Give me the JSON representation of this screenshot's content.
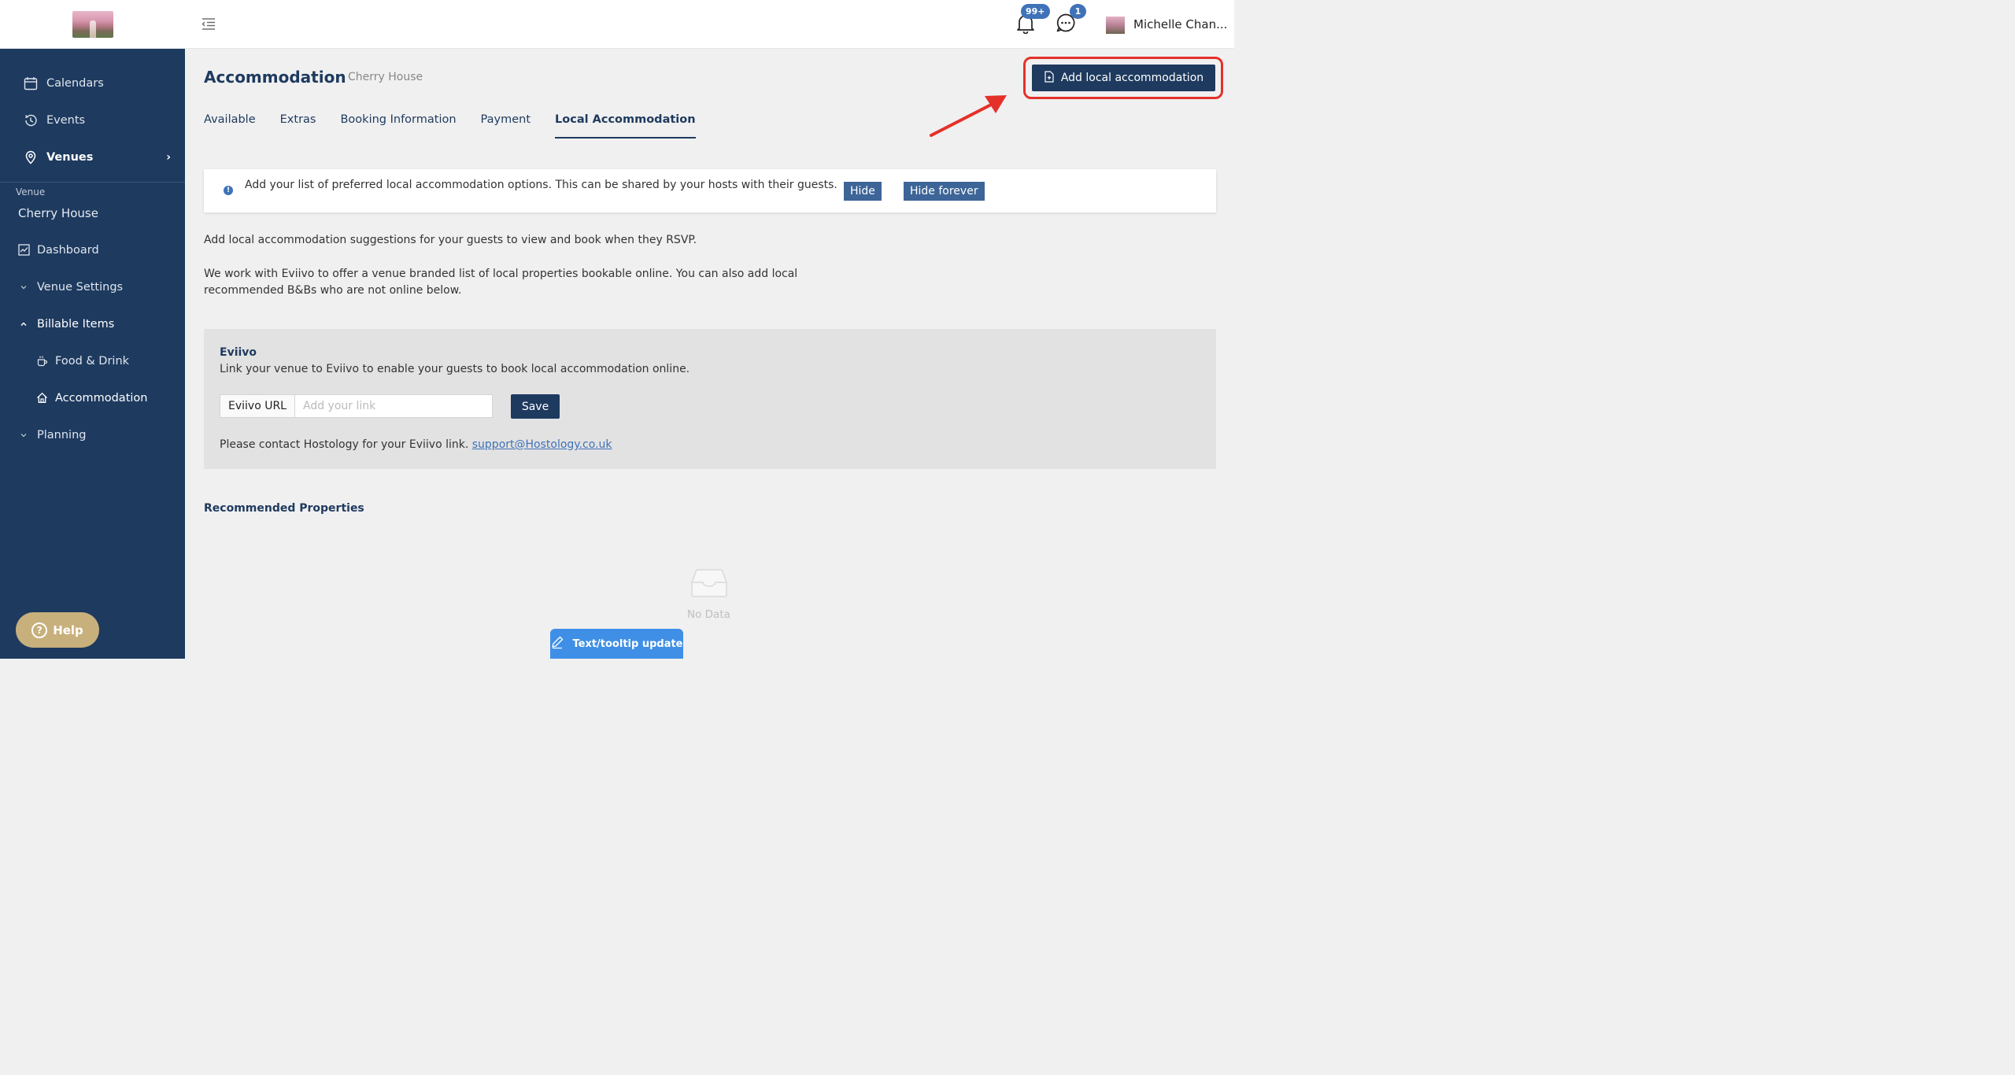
{
  "sidebar": {
    "nav": [
      {
        "label": "Calendars",
        "icon": "calendar-icon"
      },
      {
        "label": "Events",
        "icon": "history-icon"
      },
      {
        "label": "Venues",
        "icon": "location-pin-icon"
      }
    ],
    "section_label": "Venue",
    "venue_name": "Cherry House",
    "items": [
      {
        "label": "Dashboard",
        "icon": "dashboard-icon"
      },
      {
        "label": "Venue Settings",
        "icon": "chevron-down-icon"
      },
      {
        "label": "Billable Items",
        "icon": "chevron-up-icon"
      },
      {
        "label": "Food & Drink",
        "icon": "coffee-cup-icon"
      },
      {
        "label": "Accommodation",
        "icon": "home-icon"
      },
      {
        "label": "Planning",
        "icon": "chevron-down-icon"
      }
    ],
    "help_label": "Help"
  },
  "header": {
    "notifications_count": "99+",
    "messages_count": "1",
    "user_name": "Michelle Chan..."
  },
  "page": {
    "title": "Accommodation",
    "subtitle": "Cherry House",
    "add_button": "Add local accommodation",
    "tabs": [
      "Available",
      "Extras",
      "Booking Information",
      "Payment",
      "Local Accommodation"
    ],
    "active_tab": "Local Accommodation",
    "info": {
      "text": "Add your list of preferred local accommodation options. This can be shared by your hosts with their guests.",
      "hide": "Hide",
      "hide_forever": "Hide forever"
    },
    "para1": "Add local accommodation suggestions for your guests to view and book when they RSVP.",
    "para2": "We work with Eviivo to offer a venue branded list of local properties bookable online. You can also add local recommended B&Bs who are not online below.",
    "eviivo": {
      "title": "Eviivo",
      "description": "Link your venue to Eviivo to enable your guests to book local accommodation online.",
      "addon_label": "Eviivo URL",
      "placeholder": "Add your link",
      "save": "Save",
      "contact_text": "Please contact Hostology for your Eviivo link.",
      "contact_email": "support@Hostology.co.uk"
    },
    "recommended_title": "Recommended Properties",
    "empty_text": "No Data",
    "tooltip_update": "Text/tooltip update"
  },
  "colors": {
    "sidebar_bg": "#1e3a5f",
    "accent": "#3f72b8",
    "highlight": "#e5302a"
  }
}
